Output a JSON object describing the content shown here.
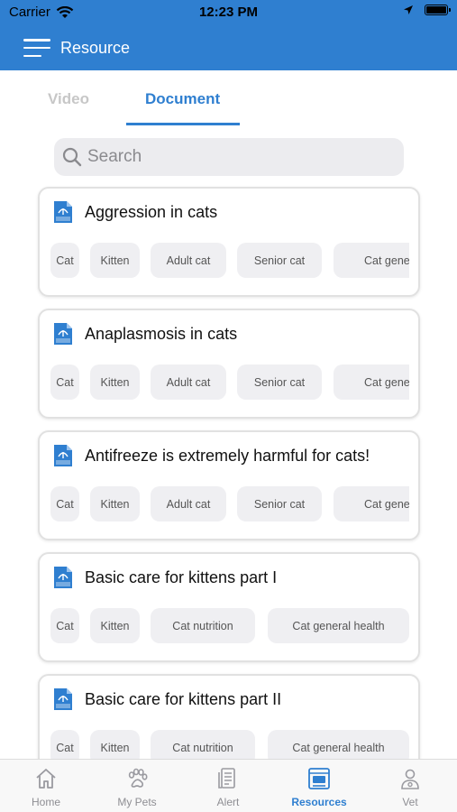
{
  "status_bar": {
    "carrier": "Carrier",
    "time": "12:23 PM"
  },
  "header": {
    "title": "Resource"
  },
  "tabs": [
    {
      "label": "Video",
      "active": false
    },
    {
      "label": "Document",
      "active": true
    }
  ],
  "search": {
    "placeholder": "Search"
  },
  "documents": [
    {
      "title": "Aggression in cats",
      "tags": [
        "Cat",
        "Kitten",
        "Adult cat",
        "Senior cat",
        "Cat gene"
      ]
    },
    {
      "title": "Anaplasmosis in cats",
      "tags": [
        "Cat",
        "Kitten",
        "Adult cat",
        "Senior cat",
        "Cat gene"
      ]
    },
    {
      "title": "Antifreeze is extremely harmful for cats!",
      "tags": [
        "Cat",
        "Kitten",
        "Adult cat",
        "Senior cat",
        "Cat gene"
      ]
    },
    {
      "title": "Basic care for kittens part I",
      "tags": [
        "Cat",
        "Kitten",
        "Cat nutrition",
        "Cat general health"
      ]
    },
    {
      "title": "Basic care for kittens part II",
      "tags": [
        "Cat",
        "Kitten",
        "Cat nutrition",
        "Cat general health"
      ]
    }
  ],
  "bottom_nav": [
    {
      "label": "Home",
      "icon": "home-icon",
      "active": false
    },
    {
      "label": "My Pets",
      "icon": "paw-icon",
      "active": false
    },
    {
      "label": "Alert",
      "icon": "alert-document-icon",
      "active": false
    },
    {
      "label": "Resources",
      "icon": "resources-icon",
      "active": true
    },
    {
      "label": "Vet",
      "icon": "vet-icon",
      "active": false
    }
  ],
  "colors": {
    "primary": "#2f7fd0",
    "inactive_tab": "#c7c7c7",
    "chip_bg": "#efeff2"
  }
}
